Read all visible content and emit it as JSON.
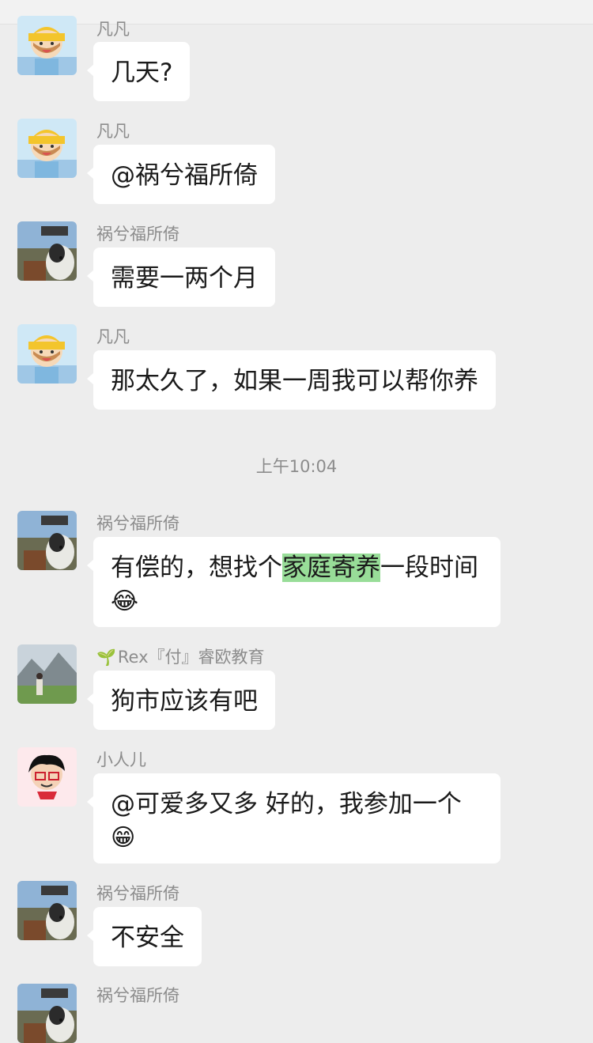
{
  "time_divider": "上午10:04",
  "messages": [
    {
      "sender": "凡凡",
      "text": "几天?"
    },
    {
      "sender": "凡凡",
      "text": "@祸兮福所倚"
    },
    {
      "sender": "祸兮福所倚",
      "text": "需要一两个月"
    },
    {
      "sender": "凡凡",
      "text": "那太久了，如果一周我可以帮你养"
    },
    {
      "sender": "祸兮福所倚",
      "text_before": "有偿的，想找个",
      "highlight": "家庭寄养",
      "text_after": "一段时间",
      "emoji": "😂"
    },
    {
      "sender": "Rex『付』睿欧教育",
      "sender_prefix_icon": "sprout-icon",
      "text": "狗市应该有吧"
    },
    {
      "sender": "小人儿",
      "text": "@可爱多又多  好的，我参加一个",
      "emoji": "😁"
    },
    {
      "sender": "祸兮福所倚",
      "text": "不安全"
    },
    {
      "sender": "祸兮福所倚",
      "text": ""
    }
  ],
  "colors": {
    "background": "#ededed",
    "bubble": "#ffffff",
    "highlight": "#98dd98",
    "sender_text": "#8c8c8c"
  }
}
